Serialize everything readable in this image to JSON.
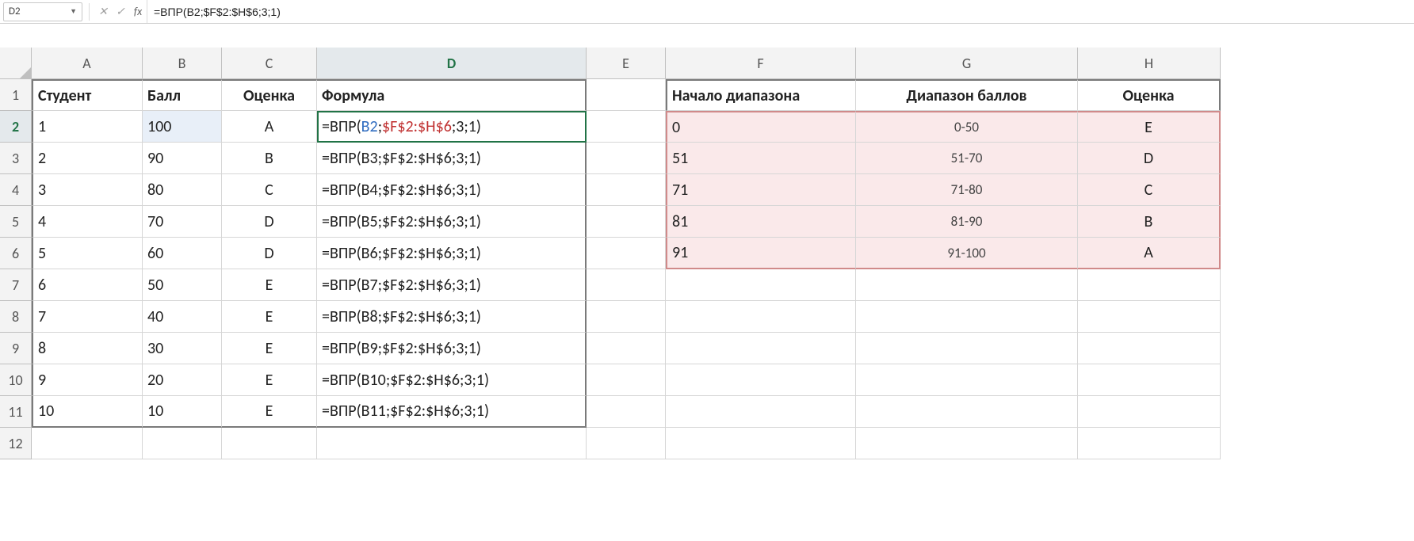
{
  "namebox": "D2",
  "formula_bar": "=ВПР(B2;$F$2:$H$6;3;1)",
  "col_headers": [
    "A",
    "B",
    "C",
    "D",
    "E",
    "F",
    "G",
    "H"
  ],
  "row_headers": [
    "1",
    "2",
    "3",
    "4",
    "5",
    "6",
    "7",
    "8",
    "9",
    "10",
    "11",
    "12"
  ],
  "headers": {
    "A": "Студент",
    "B": "Балл",
    "C": "Оценка",
    "D": "Формула",
    "F": "Начало диапазона",
    "G": "Диапазон баллов",
    "H": "Оценка"
  },
  "students": [
    {
      "id": "1",
      "score": "100",
      "grade": "A",
      "formula": "=ВПР(B2;$F$2:$H$6;3;1)",
      "d2": true
    },
    {
      "id": "2",
      "score": "90",
      "grade": "B",
      "formula": "=ВПР(B3;$F$2:$H$6;3;1)"
    },
    {
      "id": "3",
      "score": "80",
      "grade": "C",
      "formula": "=ВПР(B4;$F$2:$H$6;3;1)"
    },
    {
      "id": "4",
      "score": "70",
      "grade": "D",
      "formula": "=ВПР(B5;$F$2:$H$6;3;1)"
    },
    {
      "id": "5",
      "score": "60",
      "grade": "D",
      "formula": "=ВПР(B6;$F$2:$H$6;3;1)"
    },
    {
      "id": "6",
      "score": "50",
      "grade": "E",
      "formula": "=ВПР(B7;$F$2:$H$6;3;1)"
    },
    {
      "id": "7",
      "score": "40",
      "grade": "E",
      "formula": "=ВПР(B8;$F$2:$H$6;3;1)"
    },
    {
      "id": "8",
      "score": "30",
      "grade": "E",
      "formula": "=ВПР(B9;$F$2:$H$6;3;1)"
    },
    {
      "id": "9",
      "score": "20",
      "grade": "E",
      "formula": "=ВПР(B10;$F$2:$H$6;3;1)"
    },
    {
      "id": "10",
      "score": "10",
      "grade": "E",
      "formula": "=ВПР(B11;$F$2:$H$6;3;1)"
    }
  ],
  "lookup": [
    {
      "start": "0",
      "range": "0-50",
      "grade": "E"
    },
    {
      "start": "51",
      "range": "51-70",
      "grade": "D"
    },
    {
      "start": "71",
      "range": "71-80",
      "grade": "C"
    },
    {
      "start": "81",
      "range": "81-90",
      "grade": "B"
    },
    {
      "start": "91",
      "range": "91-100",
      "grade": "A"
    }
  ],
  "d2_parts": {
    "p1": "=ВПР(",
    "p2": "B2",
    "p3": ";",
    "p4": "$F$2:$H$6",
    "p5": ";3;1)"
  }
}
